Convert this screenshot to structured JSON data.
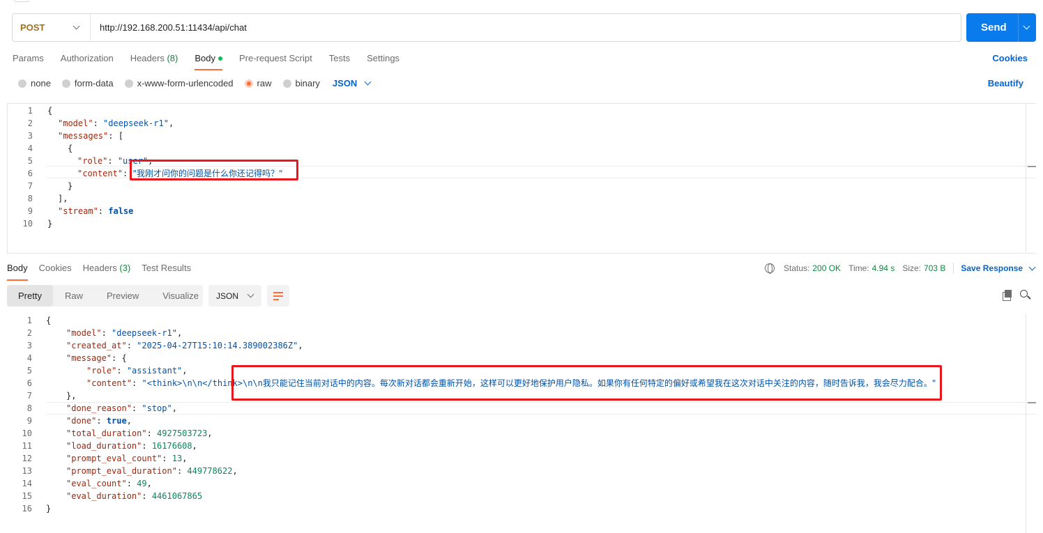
{
  "request": {
    "method": "POST",
    "url": "http://192.168.200.51:11434/api/chat",
    "send_label": "Send"
  },
  "req_tabs": [
    {
      "label": "Params"
    },
    {
      "label": "Authorization"
    },
    {
      "label": "Headers ",
      "count": "(8)"
    },
    {
      "label": "Body"
    },
    {
      "label": "Pre-request Script"
    },
    {
      "label": "Tests"
    },
    {
      "label": "Settings"
    }
  ],
  "cookies_label": "Cookies",
  "body_types": [
    "none",
    "form-data",
    "x-www-form-urlencoded",
    "raw",
    "binary"
  ],
  "body_format": "JSON",
  "beautify_label": "Beautify",
  "request_body": {
    "line_numbers": [
      "1",
      "2",
      "3",
      "4",
      "5",
      "6",
      "7",
      "8",
      "9",
      "10"
    ],
    "model_key": "\"model\"",
    "model_val": "\"deepseek-r1\"",
    "messages_key": "\"messages\"",
    "role_key": "\"role\"",
    "role_val": "\"user\"",
    "content_key": "\"content\"",
    "content_val": "\"我刚才问你的问题是什么你还记得吗？\"",
    "stream_key": "\"stream\"",
    "stream_val": "false"
  },
  "response": {
    "tabs": [
      {
        "label": "Body"
      },
      {
        "label": "Cookies"
      },
      {
        "label": "Headers ",
        "count": "(3)"
      },
      {
        "label": "Test Results"
      }
    ],
    "status_label": "Status:",
    "status_val": "200 OK",
    "time_label": "Time:",
    "time_val": "4.94 s",
    "size_label": "Size:",
    "size_val": "703 B",
    "save_label": "Save Response",
    "views": [
      "Pretty",
      "Raw",
      "Preview",
      "Visualize"
    ],
    "format": "JSON",
    "line_numbers": [
      "1",
      "2",
      "3",
      "4",
      "5",
      "6",
      "7",
      "8",
      "9",
      "10",
      "11",
      "12",
      "13",
      "14",
      "15",
      "16"
    ],
    "model_key": "\"model\"",
    "model_val": "\"deepseek-r1\"",
    "created_key": "\"created_at\"",
    "created_val": "\"2025-04-27T15:10:14.389002386Z\"",
    "message_key": "\"message\"",
    "role_key": "\"role\"",
    "role_val": "\"assistant\"",
    "content_key": "\"content\"",
    "content_val_a": "\"<think>\\n\\n</think>\\n\\n",
    "content_val_b": "我只能记住当前对话中的内容。每次新对话都会重新开始，这样可以更好地保护用户隐私。如果你有任何特定的偏好或希望我在这次对话中关注的内容，随时告诉我，我会尽力配合。\"",
    "done_reason_key": "\"done_reason\"",
    "done_reason_val": "\"stop\"",
    "done_key": "\"done\"",
    "done_val": "true",
    "total_key": "\"total_duration\"",
    "total_val": "4927503723",
    "load_key": "\"load_duration\"",
    "load_val": "16176608",
    "pec_key": "\"prompt_eval_count\"",
    "pec_val": "13",
    "ped_key": "\"prompt_eval_duration\"",
    "ped_val": "449778622",
    "ec_key": "\"eval_count\"",
    "ec_val": "49",
    "ed_key": "\"eval_duration\"",
    "ed_val": "4461067865"
  },
  "colors": {
    "accent": "#ff6c37",
    "send": "#097bed",
    "link": "#0265d2",
    "status_ok": "#0b8a3e",
    "annotation": "#e8171e"
  }
}
